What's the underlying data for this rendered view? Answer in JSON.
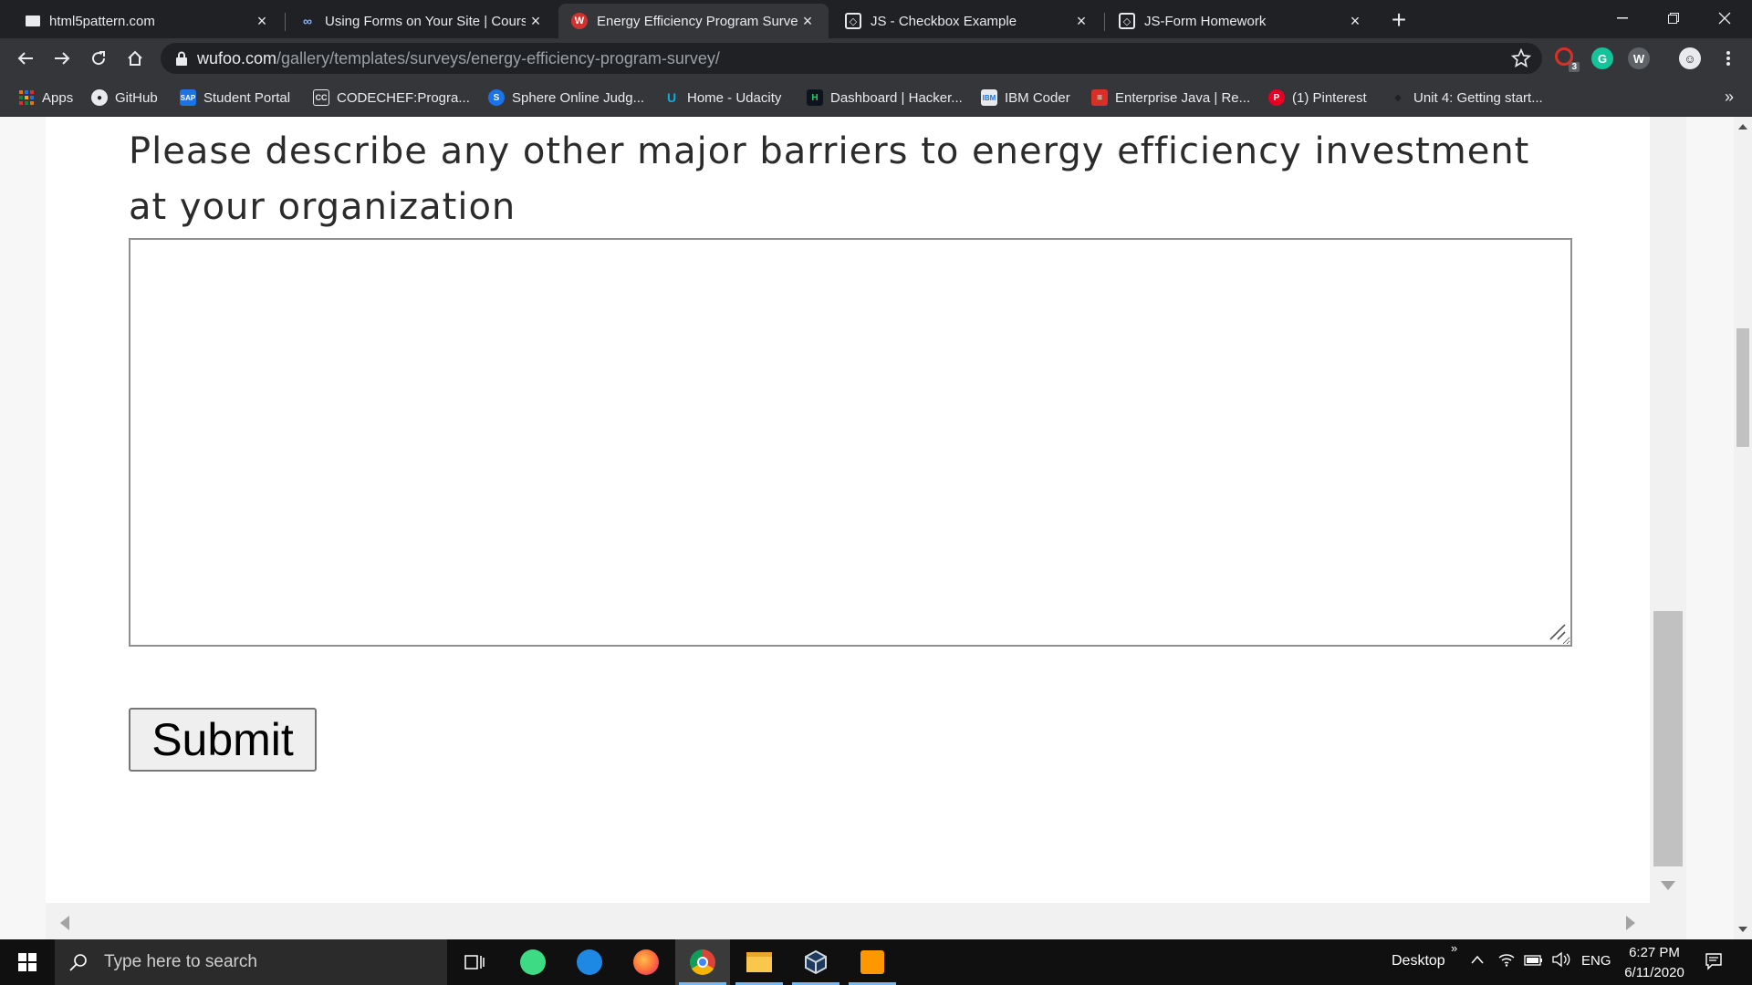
{
  "browser": {
    "tabs": [
      {
        "title": "html5pattern.com",
        "active": false
      },
      {
        "title": "Using Forms on Your Site | Course",
        "active": false
      },
      {
        "title": "Energy Efficiency Program Survey",
        "active": true
      },
      {
        "title": "JS - Checkbox Example",
        "active": false
      },
      {
        "title": "JS-Form Homework",
        "active": false
      }
    ],
    "address": {
      "host": "wufoo.com",
      "path": "/gallery/templates/surveys/energy-efficiency-program-survey/"
    },
    "extensions": {
      "badge_count": "3"
    },
    "bookmarks": [
      {
        "label": "Apps"
      },
      {
        "label": "GitHub"
      },
      {
        "label": "Student Portal"
      },
      {
        "label": "CODECHEF:Progra..."
      },
      {
        "label": "Sphere Online Judg..."
      },
      {
        "label": "Home - Udacity"
      },
      {
        "label": "Dashboard | Hacker..."
      },
      {
        "label": "IBM Coder"
      },
      {
        "label": "Enterprise Java | Re..."
      },
      {
        "label": "(1) Pinterest"
      },
      {
        "label": "Unit 4: Getting start..."
      }
    ],
    "more_bookmarks": "»"
  },
  "form": {
    "question_line1": "Please describe any other major barriers to energy efficiency investment",
    "question_line2": "at your organization",
    "answer_value": "",
    "submit_label": "Submit"
  },
  "taskbar": {
    "search_placeholder": "Type here to search",
    "desktop_label": "Desktop",
    "toolbar_chevron": "»",
    "language": "ENG",
    "time": "6:27 PM",
    "date": "6/11/2020"
  },
  "colors": {
    "chrome_dark": "#202124",
    "chrome_toolbar": "#35363a",
    "taskbar": "#101010",
    "wufoo_red": "#d2322d"
  }
}
